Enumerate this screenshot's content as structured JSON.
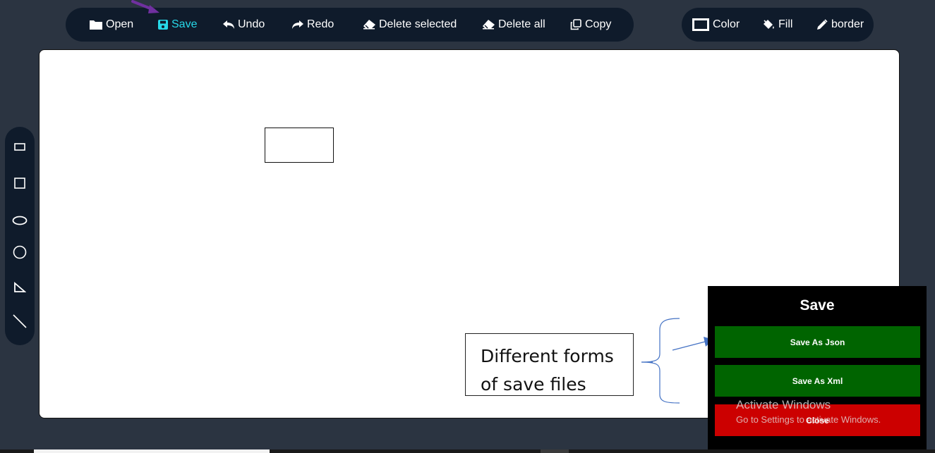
{
  "toolbar": {
    "open_label": "Open",
    "save_label": "Save",
    "undo_label": "Undo",
    "redo_label": "Redo",
    "delete_selected_label": "Delete selected",
    "delete_all_label": "Delete all",
    "copy_label": "Copy"
  },
  "style_toolbar": {
    "color_label": "Color",
    "fill_label": "Fill",
    "border_label": "border"
  },
  "shape_tools": [
    "rectangle",
    "square",
    "ellipse",
    "circle",
    "triangle",
    "line"
  ],
  "annotation": {
    "callout_text": "Different forms of save files"
  },
  "save_dialog": {
    "title": "Save",
    "save_json_label": "Save As Json",
    "save_xml_label": "Save As Xml",
    "close_label": "Close"
  },
  "watermark": {
    "title": "Activate Windows",
    "subtitle": "Go to Settings to activate Windows."
  },
  "colors": {
    "toolbar_bg": "#0f1b2b",
    "page_bg": "#2b3441",
    "active_accent": "#27d8e8",
    "save_button_green": "#006400",
    "close_button_red": "#cc0000",
    "annotation_blue": "#4472c4",
    "arrow_purple": "#7030a0"
  },
  "icons": {
    "open": "folder-icon",
    "save": "floppy-disk-icon",
    "undo": "undo-arrow-icon",
    "redo": "redo-arrow-icon",
    "delete_selected": "eraser-icon",
    "delete_all": "eraser-icon",
    "copy": "copy-icon",
    "color": "color-swatch-icon",
    "fill": "paint-bucket-icon",
    "border": "pencil-icon"
  }
}
